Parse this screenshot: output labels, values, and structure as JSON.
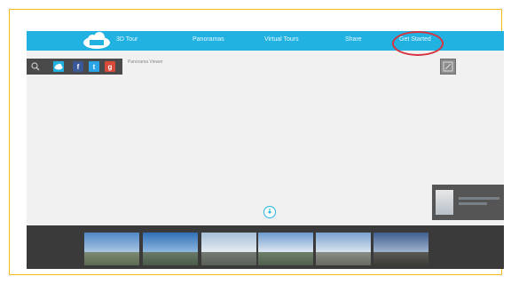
{
  "app": {
    "logo_text": "",
    "name": "3D Tour"
  },
  "navbar": {
    "items": [
      {
        "label": "Panoramas"
      },
      {
        "label": "Virtual Tours"
      },
      {
        "label": "Share"
      },
      {
        "label": "Get Started"
      }
    ],
    "highlighted_index": 3,
    "accent_color": "#22b2e2",
    "highlight_color": "#d6333f"
  },
  "toolbar": {
    "icons": [
      "search-icon",
      "cloud-upload-icon",
      "facebook-icon",
      "twitter-icon",
      "google-plus-icon"
    ],
    "fb_label": "f",
    "tw_label": "t",
    "gp_label": "g"
  },
  "viewer": {
    "caption": "Panorama Viewer"
  },
  "filmstrip": {
    "thumb_count": 6
  }
}
